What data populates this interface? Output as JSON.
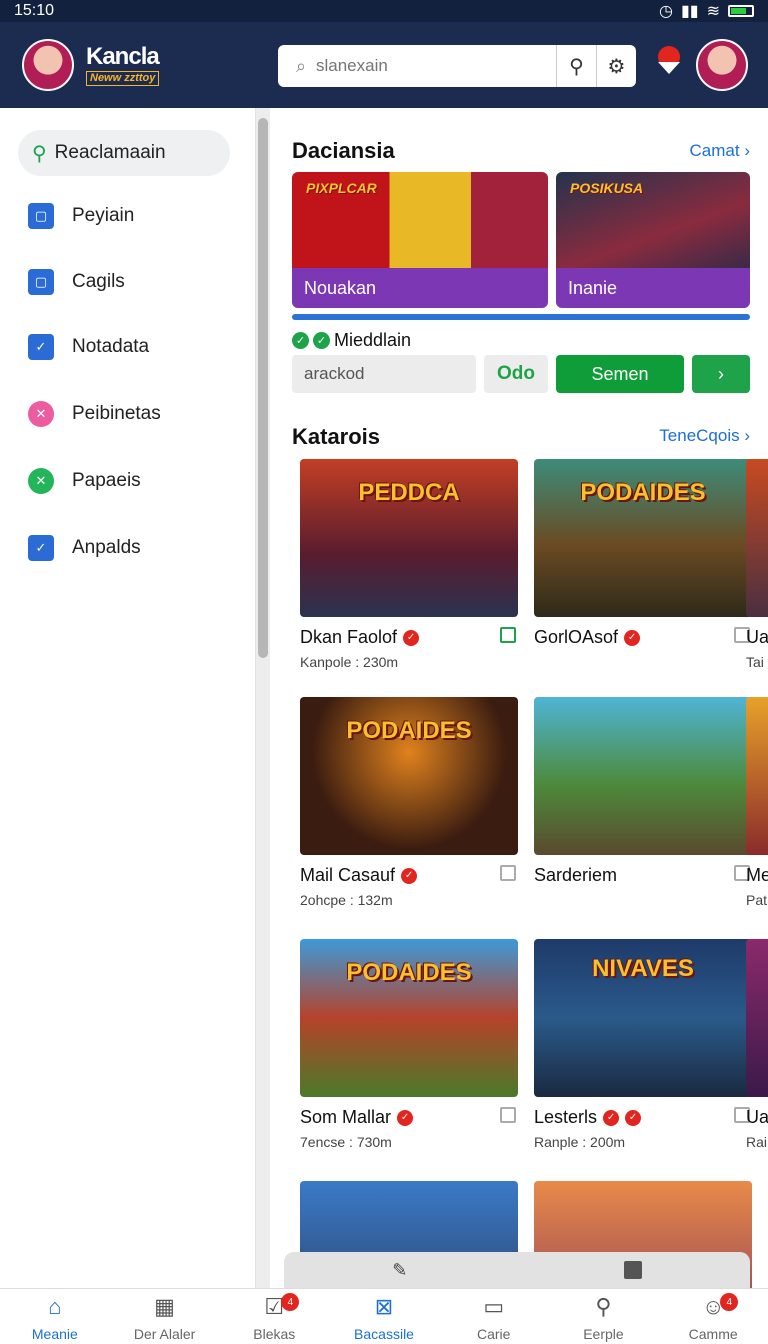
{
  "status": {
    "time": "15:10",
    "icons": [
      "clock-icon",
      "signal-icon",
      "wifi-icon",
      "battery-icon"
    ]
  },
  "header": {
    "brand": "Kancla",
    "brand_sub": "Neww zzttoy",
    "search_placeholder": "slanexain"
  },
  "sidebar": {
    "search_label": "Reaclamaain",
    "items": [
      {
        "label": "Peyiain",
        "icon": "square-icon"
      },
      {
        "label": "Cagils",
        "icon": "square-icon"
      },
      {
        "label": "Notadata",
        "icon": "check-square-icon"
      },
      {
        "label": "Peibinetas",
        "icon": "close-circle-icon"
      },
      {
        "label": "Papaeis",
        "icon": "close-circle-icon"
      },
      {
        "label": "Anpalds",
        "icon": "check-square-icon"
      }
    ]
  },
  "featured": {
    "title": "Daciansia",
    "link": "Camat ›",
    "cards": [
      {
        "caption": "Nouakan",
        "logo": "PIXPLCAR"
      },
      {
        "caption": "Inanie",
        "logo": "POSIKUSA"
      }
    ],
    "progress": 1.0,
    "status_text": "Mieddlain",
    "field_placeholder": "arackod",
    "btn_odo": "Odo",
    "btn_semen": "Semen",
    "btn_next": "›"
  },
  "catalog": {
    "title": "Katarois",
    "link": "TeneCqois ›",
    "cards": [
      {
        "title": "PEDDCA",
        "name": "Dkan Faolof",
        "meta": "Kanpole : 230m",
        "checked": true
      },
      {
        "title": "PODAIDES",
        "name": "GorlOAsof",
        "meta": "",
        "checked": false
      },
      {
        "title": "",
        "name": "Ua",
        "meta": "Tai",
        "checked": false
      },
      {
        "title": "PODAIDES",
        "name": "Mail Casauf",
        "meta": "2ohcpe : 132m",
        "checked": false
      },
      {
        "title": "",
        "name": "Sarderiem",
        "meta": "",
        "checked": false
      },
      {
        "title": "",
        "name": "Me",
        "meta": "Pat",
        "checked": false
      },
      {
        "title": "PODAIDES",
        "name": "Som Mallar",
        "meta": "7encse : 730m",
        "checked": false
      },
      {
        "title": "NIVAVES",
        "name": "Lesterls",
        "meta": "Ranple : 200m",
        "checked": false
      },
      {
        "title": "",
        "name": "Ua",
        "meta": "Rai",
        "checked": false
      },
      {
        "title": "",
        "name": "",
        "meta": "",
        "checked": false
      },
      {
        "title": "",
        "name": "",
        "meta": "",
        "checked": false
      }
    ]
  },
  "bottom_nav": [
    {
      "label": "Meanie",
      "icon": "home-icon",
      "active": true,
      "badge": ""
    },
    {
      "label": "Der Alaler",
      "icon": "building-icon",
      "active": false,
      "badge": ""
    },
    {
      "label": "Blekas",
      "icon": "clipboard-icon",
      "active": false,
      "badge": "4"
    },
    {
      "label": "Bacassile",
      "icon": "square-x-icon",
      "active": true,
      "badge": ""
    },
    {
      "label": "Carie",
      "icon": "window-icon",
      "active": false,
      "badge": ""
    },
    {
      "label": "Eerple",
      "icon": "search-icon",
      "active": false,
      "badge": ""
    },
    {
      "label": "Camme",
      "icon": "user-icon",
      "active": false,
      "badge": "4"
    }
  ],
  "colors": {
    "header": "#1b2c50",
    "accent": "#1c6fd6",
    "green": "#1ea34a",
    "purple": "#7b37b4",
    "red": "#e3251f"
  }
}
